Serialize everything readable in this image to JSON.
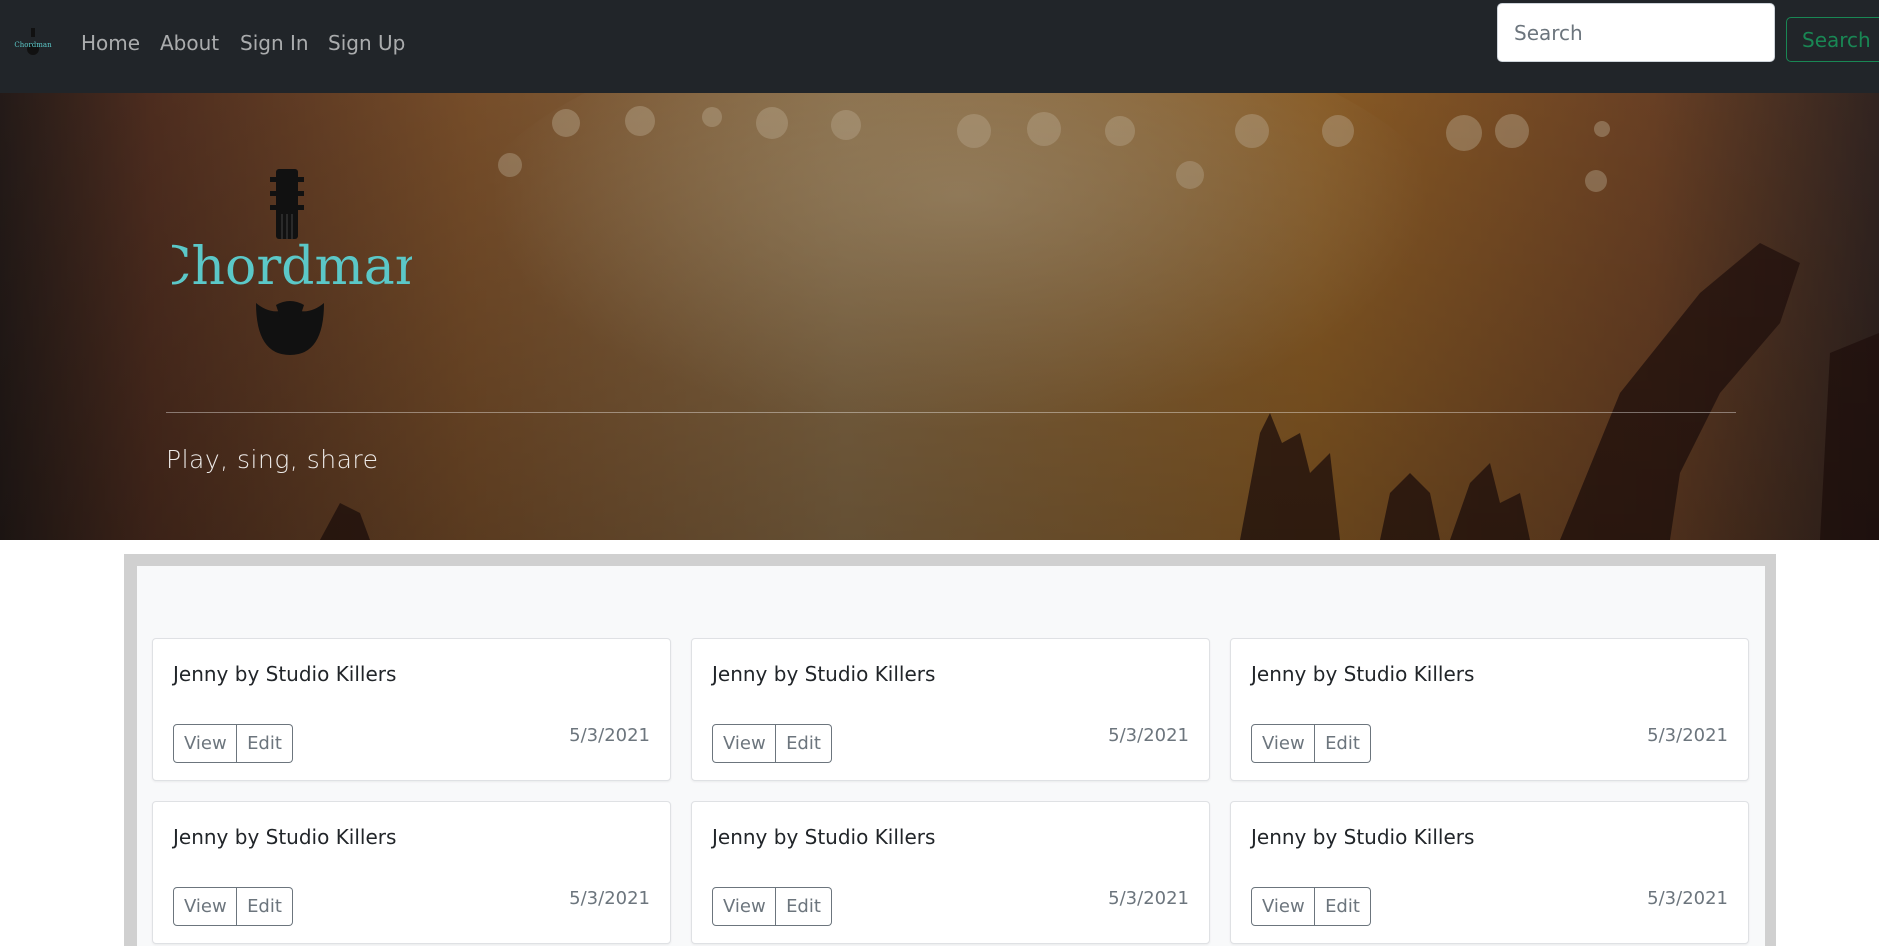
{
  "navbar": {
    "brand_text": "Chordman",
    "links": [
      "Home",
      "About",
      "Sign In",
      "Sign Up"
    ],
    "search_placeholder": "Search",
    "search_button": "Search"
  },
  "hero": {
    "logo_text": "Chordman",
    "tagline": "Play, sing, share"
  },
  "songs": [
    {
      "title": "Jenny by Studio Killers",
      "view_label": "View",
      "edit_label": "Edit",
      "date": "5/3/2021"
    },
    {
      "title": "Jenny by Studio Killers",
      "view_label": "View",
      "edit_label": "Edit",
      "date": "5/3/2021"
    },
    {
      "title": "Jenny by Studio Killers",
      "view_label": "View",
      "edit_label": "Edit",
      "date": "5/3/2021"
    },
    {
      "title": "Jenny by Studio Killers",
      "view_label": "View",
      "edit_label": "Edit",
      "date": "5/3/2021"
    },
    {
      "title": "Jenny by Studio Killers",
      "view_label": "View",
      "edit_label": "Edit",
      "date": "5/3/2021"
    },
    {
      "title": "Jenny by Studio Killers",
      "view_label": "View",
      "edit_label": "Edit",
      "date": "5/3/2021"
    }
  ],
  "colors": {
    "navbar_bg": "#212529",
    "brand_teal": "#5bc8c8",
    "success": "#198754",
    "secondary": "#6c757d"
  }
}
